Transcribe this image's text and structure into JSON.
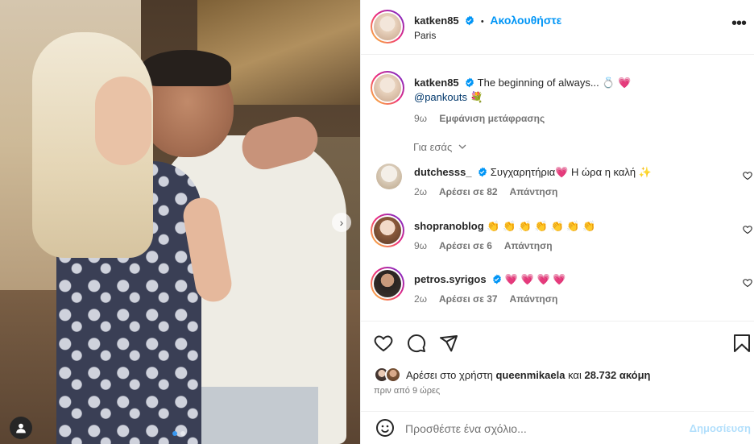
{
  "colors": {
    "accent": "#0095f6",
    "verified": "#0095f6",
    "muted": "#737373",
    "text": "#262626"
  },
  "header": {
    "username": "katken85",
    "separator": "•",
    "follow_label": "Ακολουθήστε",
    "location": "Paris",
    "more_icon": "more-horizontal-icon"
  },
  "caption": {
    "username": "katken85",
    "text": "The beginning of always... 💍 💗",
    "mention": "@pankouts",
    "mention_emoji": "💐",
    "time": "9ω",
    "translate_label": "Εμφάνιση μετάφρασης"
  },
  "for_you_label": "Για εσάς",
  "comments": [
    {
      "username": "dutchesss_",
      "text": "Συγχαρητήρια💗  Η ώρα η καλή ✨",
      "time": "2ω",
      "likes": "Αρέσει σε 82",
      "reply": "Απάντηση"
    },
    {
      "username": "shopranoblog",
      "text": "👏 👏 👏 👏 👏 👏 👏",
      "time": "9ω",
      "likes": "Αρέσει σε 6",
      "reply": "Απάντηση"
    },
    {
      "username": "petros.syrigos",
      "text": "💗 💗 💗 💗",
      "time": "2ω",
      "likes": "Αρέσει σε 37",
      "reply": "Απάντηση"
    }
  ],
  "likes": {
    "prefix": "Αρέσει στο χρήστη",
    "user": "queenmikaela",
    "middle": "και",
    "count": "28.732 ακόμη",
    "time": "πριν από 9 ώρες"
  },
  "comment_box": {
    "placeholder": "Προσθέστε ένα σχόλιο...",
    "post_label": "Δημοσίευση"
  },
  "carousel": {
    "current": 1,
    "total": 2
  }
}
